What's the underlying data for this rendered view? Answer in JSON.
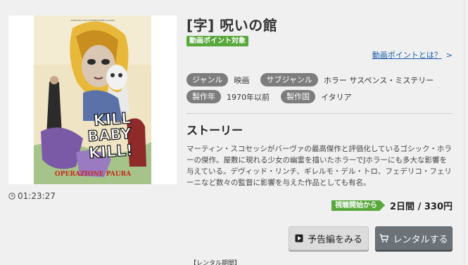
{
  "title": "[字] 呪いの館",
  "point_badge": "動画ポイント対象",
  "point_link": "動画ポイントとは？",
  "point_link_chevron": ">",
  "meta": {
    "genre_label": "ジャンル",
    "genre_value": "映画",
    "subgenre_label": "サブジャンル",
    "subgenre_value": "ホラー サスペンス・ミステリー",
    "year_label": "製作年",
    "year_value": "1970年以前",
    "country_label": "製作国",
    "country_value": "イタリア"
  },
  "story_heading": "ストーリー",
  "story_text": "マーティン・スコセッシがバーヴァの最高傑作と評価化しているゴシック・ホラーの傑作。屋敷に現れる少女の幽霊を描いたホラーでJホラーにも多大な影響を与えている。デヴィッド・リンチ、ギレルモ・デル・トロ、フェデリコ・フェリーニなど数々の監督に影響を与えた作品としても有名。",
  "duration": "01:23:27",
  "stream_badge": "視聴開始から",
  "price": "2日間 / 330円",
  "buttons": {
    "trailer": "予告編をみる",
    "rent": "レンタルする"
  },
  "rental_period": "【レンタル期間】",
  "poster": {
    "line1": "KILL",
    "line2": "BABY",
    "line3": "KILL!",
    "subtitle": "OPERAZIONE PAURA",
    "small_print": "RAPPORTO FILM DISTRIBUZIONE ITALIANA"
  },
  "icons": {
    "clock": "clock-icon",
    "play": "play-icon",
    "cart": "cart-icon"
  },
  "colors": {
    "accent_green": "#58a83c",
    "pill_gray": "#7d7d7d",
    "link_blue": "#1a5ea8",
    "rent_button": "#6b7278"
  }
}
